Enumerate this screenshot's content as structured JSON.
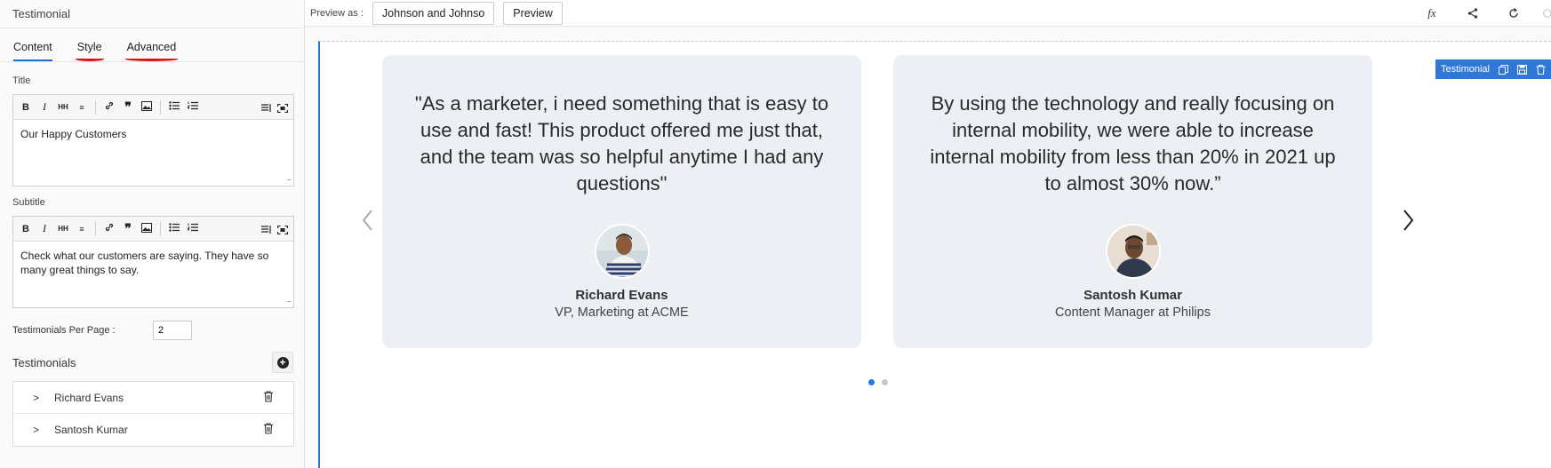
{
  "panel": {
    "header": "Testimonial",
    "tabs": [
      {
        "label": "Content"
      },
      {
        "label": "Style"
      },
      {
        "label": "Advanced"
      }
    ],
    "title_label": "Title",
    "title_value": "Our Happy Customers",
    "subtitle_label": "Subtitle",
    "subtitle_value": "Check what our customers are saying. They have so many great things to say.",
    "per_page_label": "Testimonials Per Page :",
    "per_page_value": "2",
    "testimonials_label": "Testimonials",
    "items": [
      {
        "name": "Richard Evans"
      },
      {
        "name": "Santosh Kumar"
      }
    ]
  },
  "topbar": {
    "preview_as_label": "Preview as :",
    "preview_as_value": "Johnson and Johnso",
    "preview_button": "Preview"
  },
  "widget": {
    "badge_label": "Testimonial",
    "accent_color": "#2f78d7"
  },
  "cards": [
    {
      "quote": "\"As a marketer, i need something that is easy to use and fast! This product offered me just that, and the team was so helpful anytime I had any questions\"",
      "name": "Richard Evans",
      "role": "VP, Marketing at ACME"
    },
    {
      "quote": "By using the technology and really focusing on internal mobility, we were able to increase internal mobility from less than 20% in 2021 up to almost 30% now.”",
      "name": "Santosh Kumar",
      "role": "Content Manager at Philips"
    }
  ],
  "pagination": {
    "active_page": 1,
    "total_pages": 2
  }
}
